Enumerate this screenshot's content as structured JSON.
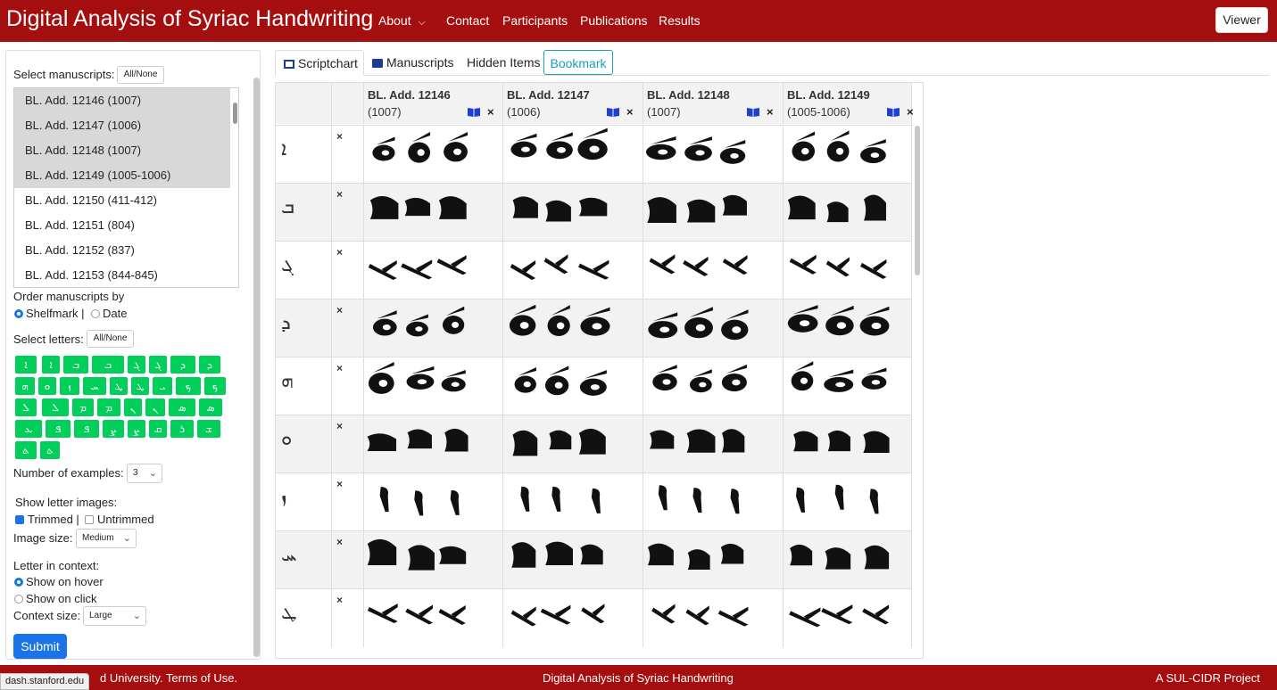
{
  "brand": "Digital Analysis of Syriac Handwriting",
  "nav": {
    "about": "About",
    "contact": "Contact",
    "participants": "Participants",
    "publications": "Publications",
    "results": "Results",
    "viewer": "Viewer"
  },
  "sidebar": {
    "select_manuscripts_label": "Select manuscripts:",
    "all_none": "All/None",
    "manuscripts": [
      {
        "label": "BL. Add. 12146 (1007)",
        "selected": true
      },
      {
        "label": "BL. Add. 12147 (1006)",
        "selected": true
      },
      {
        "label": "BL. Add. 12148 (1007)",
        "selected": true
      },
      {
        "label": "BL. Add. 12149 (1005-1006)",
        "selected": true
      },
      {
        "label": "BL. Add. 12150 (411-412)",
        "selected": false
      },
      {
        "label": "BL. Add. 12151 (804)",
        "selected": false
      },
      {
        "label": "BL. Add. 12152 (837)",
        "selected": false
      },
      {
        "label": "BL. Add. 12153 (844-845)",
        "selected": false
      }
    ],
    "order_label": "Order manuscripts by",
    "order_shelfmark": "Shelfmark |",
    "order_date": "Date",
    "select_letters_label": "Select letters:",
    "letters_all_none": "All/None",
    "letters": [
      "ܐ",
      "ܐ",
      "ܒ",
      "ܒ",
      "ܓ",
      "ܓ",
      "ܕ",
      "ܕ",
      "ܗ",
      "ܘ",
      "ܙ",
      "ܚ",
      "ܛ",
      "ܛ",
      "ܝ",
      "ܟ",
      "ܟ",
      "ܠ",
      "ܠ",
      "ܡ",
      "ܡ",
      "ܢ",
      "ܢ",
      "ܣ",
      "ܣ",
      "ܥ",
      "ܦ",
      "ܦ",
      "ܨ",
      "ܨ",
      "ܩ",
      "ܪ",
      "ܫ",
      "ܬ",
      "ܬ",
      "ܬ"
    ],
    "num_examples_label": "Number of examples:",
    "num_examples_value": "3",
    "show_images_label": "Show letter images:",
    "trimmed": "Trimmed |",
    "untrimmed": "Untrimmed",
    "image_size_label": "Image size:",
    "image_size_value": "Medium",
    "context_label": "Letter in context:",
    "show_on_hover": "Show on hover",
    "show_on_click": "Show on click",
    "context_size_label": "Context size:",
    "context_size_value": "Large",
    "submit": "Submit"
  },
  "tabs": {
    "scriptchart": "Scriptchart",
    "manuscripts": "Manuscripts",
    "hidden": "Hidden Items",
    "bookmark": "Bookmark"
  },
  "chart": {
    "columns": [
      {
        "shelfmark": "BL. Add. 12146",
        "date": "(1007)"
      },
      {
        "shelfmark": "BL. Add. 12147",
        "date": "(1006)"
      },
      {
        "shelfmark": "BL. Add. 12148",
        "date": "(1007)"
      },
      {
        "shelfmark": "BL. Add. 12149",
        "date": "(1005-1006)"
      }
    ],
    "rows": [
      "ܐ",
      "ܒ",
      "ܓ",
      "ܕ",
      "ܗ",
      "ܘ",
      "ܙ",
      "ܚ",
      "ܛ"
    ],
    "remove_symbol": "×"
  },
  "footer": {
    "left": "d University. Terms of Use.",
    "center": "Digital Analysis of Syriac Handwriting",
    "right": "A SUL-CIDR Project"
  },
  "tooltip": "dash.stanford.edu",
  "colors": {
    "brand_red": "#a50e0e",
    "letter_green": "#00d05a",
    "accent_blue": "#1a73e8",
    "bookmark_teal": "#17a2b8"
  }
}
